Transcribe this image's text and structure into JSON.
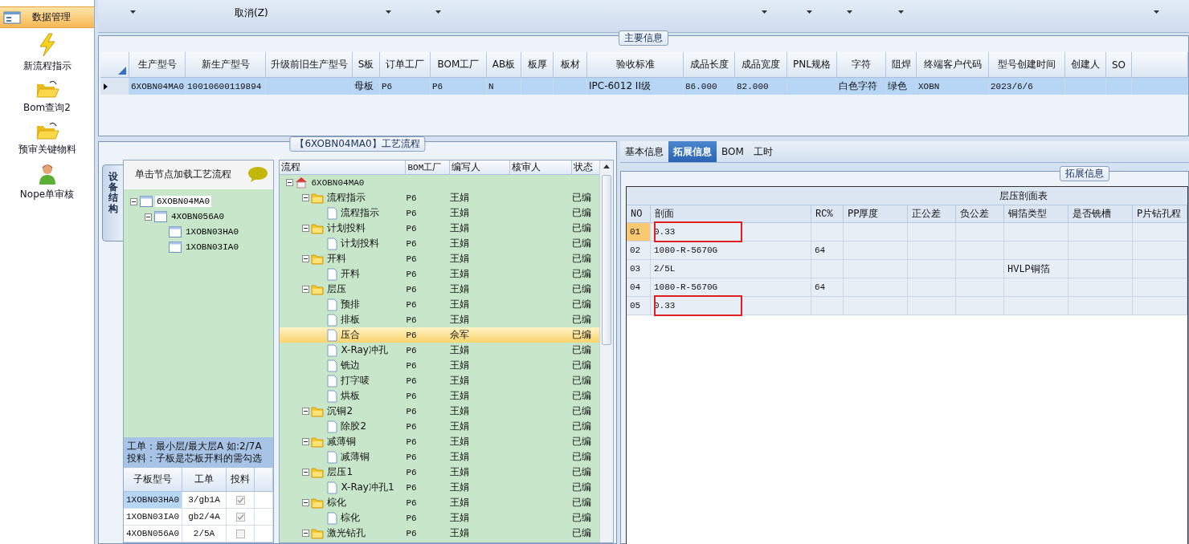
{
  "sidebar": {
    "items": [
      {
        "label": "数据管理",
        "kind": "window",
        "selected": true
      },
      {
        "label": "新流程指示",
        "kind": "lightning",
        "selected": false
      },
      {
        "label": "Bom查询2",
        "kind": "folder",
        "selected": false
      },
      {
        "label": "预审关键物料",
        "kind": "folder",
        "selected": false
      },
      {
        "label": "Nope单审核",
        "kind": "user",
        "selected": false
      }
    ]
  },
  "toolbar": {
    "cancel_label": "取消(Z)"
  },
  "main_info": {
    "title": "主要信息",
    "columns": [
      "生产型号",
      "新生产型号",
      "升级前旧生产型号",
      "S板",
      "订单工厂",
      "BOM工厂",
      "AB板",
      "板厚",
      "板材",
      "验收标准",
      "成品长度",
      "成品宽度",
      "PNL规格",
      "字符",
      "阻焊",
      "终端客户代码",
      "型号创建时间",
      "创建人",
      "SO"
    ],
    "rows": [
      {
        "selected": true,
        "cells": [
          "6XOBN04MA0",
          "10010600119894",
          null,
          "母板",
          "P6",
          "P6",
          "N",
          null,
          null,
          "IPC-6012 II级",
          "86.000",
          "82.000",
          null,
          "白色字符",
          "绿色",
          "XOBN",
          "2023/6/6",
          null,
          null
        ]
      }
    ]
  },
  "process": {
    "title": "【6XOBN04MA0】工艺流程",
    "side_tab": "设备结构",
    "structure": {
      "hint": "单击节点加载工艺流程",
      "nodes": [
        {
          "label": "6XOBN04MA0",
          "selected": true,
          "children": [
            {
              "label": "4XOBN056A0",
              "selected": false,
              "children": [
                {
                  "label": "1XOBN03HA0",
                  "selected": false
                },
                {
                  "label": "1XOBN03IA0",
                  "selected": false
                }
              ]
            }
          ]
        }
      ]
    },
    "notes": [
      "工单：最小层/最大层A 如:2/7A",
      "投料：子板是芯板开料的需勾选"
    ],
    "sub_boards": {
      "columns": [
        "子板型号",
        "工单",
        "投料"
      ],
      "rows": [
        {
          "model": "1XOBN03HA0",
          "order": "3/gb1A",
          "feed": true,
          "selected": true
        },
        {
          "model": "1XOBN03IA0",
          "order": "gb2/4A",
          "feed": true,
          "selected": false
        },
        {
          "model": "4XOBN056A0",
          "order": "2/5A",
          "feed": false,
          "selected": false
        }
      ]
    },
    "flow": {
      "columns": [
        "流程",
        "BOM工厂",
        "编写人",
        "核审人",
        "状态"
      ],
      "root": {
        "label": "6XOBN04MA0",
        "kind": "root",
        "children": [
          {
            "label": "流程指示",
            "kind": "folder",
            "bom": "P6",
            "writer": "王娟",
            "status": "已编",
            "selected": false,
            "children": [
              {
                "label": "流程指示",
                "kind": "file",
                "bom": "P6",
                "writer": "王娟",
                "status": "已编",
                "selected": false
              }
            ]
          },
          {
            "label": "计划投料",
            "kind": "folder",
            "bom": "P6",
            "writer": "王娟",
            "status": "已编",
            "selected": false,
            "children": [
              {
                "label": "计划投料",
                "kind": "file",
                "bom": "P6",
                "writer": "王娟",
                "status": "已编",
                "selected": false
              }
            ]
          },
          {
            "label": "开料",
            "kind": "folder",
            "bom": "P6",
            "writer": "王娟",
            "status": "已编",
            "selected": false,
            "children": [
              {
                "label": "开料",
                "kind": "file",
                "bom": "P6",
                "writer": "王娟",
                "status": "已编",
                "selected": false
              }
            ]
          },
          {
            "label": "层压",
            "kind": "folder",
            "bom": "P6",
            "writer": "王娟",
            "status": "已编",
            "selected": false,
            "children": [
              {
                "label": "预排",
                "kind": "file",
                "bom": "P6",
                "writer": "王娟",
                "status": "已编",
                "selected": false
              },
              {
                "label": "排板",
                "kind": "file",
                "bom": "P6",
                "writer": "王娟",
                "status": "已编",
                "selected": false
              },
              {
                "label": "压合",
                "kind": "file",
                "bom": "P6",
                "writer": "佘军",
                "status": "已编",
                "selected": true
              },
              {
                "label": "X-Ray冲孔",
                "kind": "file",
                "bom": "P6",
                "writer": "王娟",
                "status": "已编",
                "selected": false
              },
              {
                "label": "铣边",
                "kind": "file",
                "bom": "P6",
                "writer": "王娟",
                "status": "已编",
                "selected": false
              },
              {
                "label": "打字唛",
                "kind": "file",
                "bom": "P6",
                "writer": "王娟",
                "status": "已编",
                "selected": false
              },
              {
                "label": "烘板",
                "kind": "file",
                "bom": "P6",
                "writer": "王娟",
                "status": "已编",
                "selected": false
              }
            ]
          },
          {
            "label": "沉铜2",
            "kind": "folder",
            "bom": "P6",
            "writer": "王娟",
            "status": "已编",
            "selected": false,
            "children": [
              {
                "label": "除胶2",
                "kind": "file",
                "bom": "P6",
                "writer": "王娟",
                "status": "已编",
                "selected": false
              }
            ]
          },
          {
            "label": "减薄铜",
            "kind": "folder",
            "bom": "P6",
            "writer": "王娟",
            "status": "已编",
            "selected": false,
            "children": [
              {
                "label": "减薄铜",
                "kind": "file",
                "bom": "P6",
                "writer": "王娟",
                "status": "已编",
                "selected": false
              }
            ]
          },
          {
            "label": "层压1",
            "kind": "folder",
            "bom": "P6",
            "writer": "王娟",
            "status": "已编",
            "selected": false,
            "children": [
              {
                "label": "X-Ray冲孔1",
                "kind": "file",
                "bom": "P6",
                "writer": "王娟",
                "status": "已编",
                "selected": false
              }
            ]
          },
          {
            "label": "棕化",
            "kind": "folder",
            "bom": "P6",
            "writer": "王娟",
            "status": "已编",
            "selected": false,
            "children": [
              {
                "label": "棕化",
                "kind": "file",
                "bom": "P6",
                "writer": "王娟",
                "status": "已编",
                "selected": false
              }
            ]
          },
          {
            "label": "激光钻孔",
            "kind": "folder",
            "bom": "P6",
            "writer": "王娟",
            "status": "已编",
            "selected": false
          }
        ]
      }
    }
  },
  "details": {
    "tabs": [
      {
        "label": "基本信息",
        "selected": false
      },
      {
        "label": "拓展信息",
        "selected": true
      },
      {
        "label": "BOM",
        "selected": false
      },
      {
        "label": "工时",
        "selected": false
      }
    ],
    "group_title": "拓展信息",
    "table": {
      "title": "层压剖面表",
      "columns": [
        "NO",
        "剖面",
        "RC%",
        "PP厚度",
        "正公差",
        "负公差",
        "铜箔类型",
        "是否铣槽",
        "P片钻孔程"
      ],
      "rows": [
        {
          "selected": true,
          "marked": true,
          "cells": [
            "01",
            "0.33",
            null,
            null,
            null,
            null,
            null,
            null,
            null
          ]
        },
        {
          "selected": false,
          "marked": false,
          "cells": [
            "02",
            "1080-R-5670G",
            "64",
            null,
            null,
            null,
            null,
            null,
            null
          ]
        },
        {
          "selected": false,
          "marked": false,
          "cells": [
            "03",
            "2/5L",
            null,
            null,
            null,
            null,
            "HVLP铜箔",
            null,
            null
          ]
        },
        {
          "selected": false,
          "marked": false,
          "cells": [
            "04",
            "1080-R-5670G",
            "64",
            null,
            null,
            null,
            null,
            null,
            null
          ]
        },
        {
          "selected": false,
          "marked": true,
          "cells": [
            "05",
            "0.33",
            null,
            null,
            null,
            null,
            null,
            null,
            null
          ]
        }
      ]
    }
  }
}
